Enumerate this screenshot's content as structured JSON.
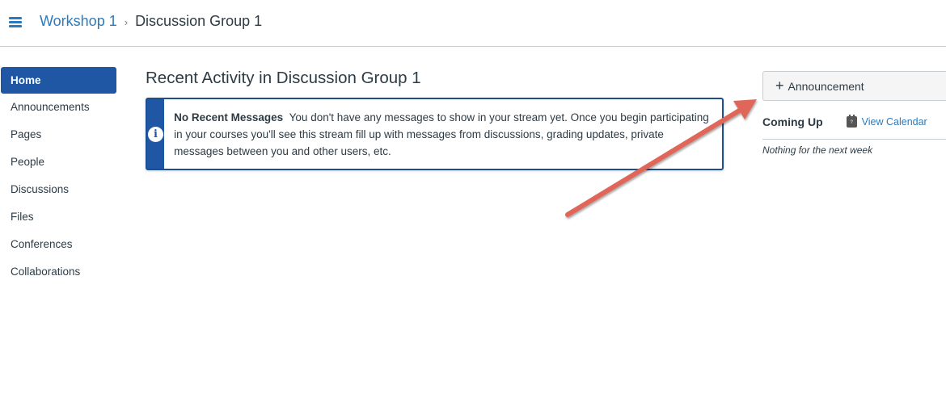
{
  "header": {
    "menu_icon": "hamburger-icon",
    "breadcrumb": {
      "parent": "Workshop 1",
      "separator": ">",
      "current": "Discussion Group 1"
    }
  },
  "sidebar": {
    "items": [
      {
        "label": "Home",
        "active": true
      },
      {
        "label": "Announcements",
        "active": false
      },
      {
        "label": "Pages",
        "active": false
      },
      {
        "label": "People",
        "active": false
      },
      {
        "label": "Discussions",
        "active": false
      },
      {
        "label": "Files",
        "active": false
      },
      {
        "label": "Conferences",
        "active": false
      },
      {
        "label": "Collaborations",
        "active": false
      }
    ]
  },
  "main": {
    "title": "Recent Activity in Discussion Group 1",
    "alert": {
      "icon": "info-icon",
      "heading": "No Recent Messages",
      "message": "You don't have any messages to show in your stream yet. Once you begin participating in your courses you'll see this stream fill up with messages from discussions, grading updates, private messages between you and other users, etc."
    }
  },
  "right": {
    "announcement_button": "Announcement",
    "coming_up": {
      "title": "Coming Up",
      "view_calendar": "View Calendar",
      "empty_text": "Nothing for the next week"
    }
  },
  "annotation": {
    "color": "#e0665a"
  }
}
